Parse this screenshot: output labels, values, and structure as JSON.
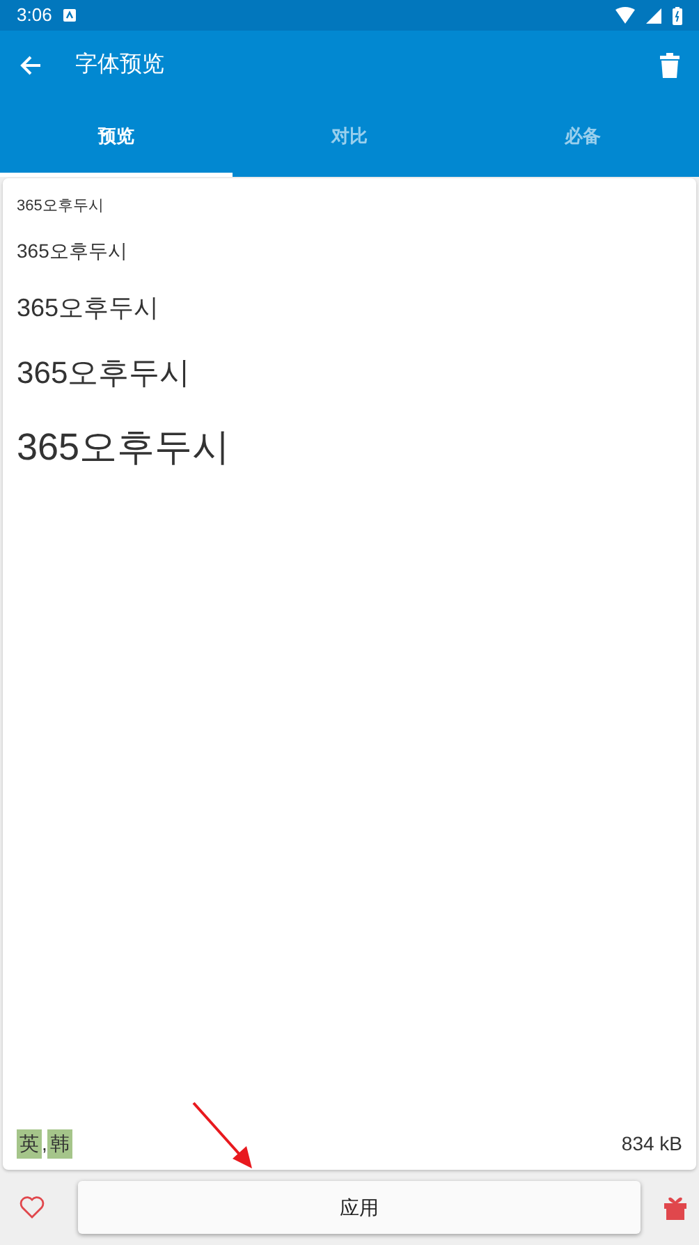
{
  "status_bar": {
    "time": "3:06"
  },
  "app_bar": {
    "title": "字体预览"
  },
  "tabs": [
    {
      "label": "预览",
      "selected": true
    },
    {
      "label": "对比",
      "selected": false
    },
    {
      "label": "必备",
      "selected": false
    }
  ],
  "samples": [
    "365오후두시",
    "365오후두시",
    "365오후두시",
    "365오후두시",
    "365오후두시"
  ],
  "languages": [
    {
      "label": "英"
    },
    {
      "label": "韩"
    }
  ],
  "language_separator": ",",
  "file_size": "834 kB",
  "apply_button": "应用"
}
